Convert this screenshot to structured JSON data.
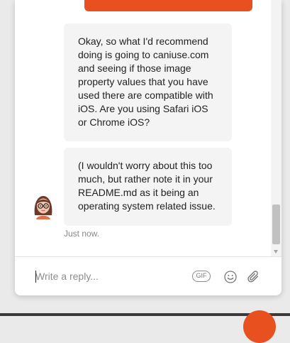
{
  "messages": [
    {
      "text": "Okay, so what I'd recommend doing is going to caniuse.com and seeing if those image property values that you have used there are compatible with iOS. Are you using Safari iOS or Chrome iOS?"
    },
    {
      "text": "(I wouldn't worry about this too much, but rather note it in your README.md as it being an operating system related issue."
    }
  ],
  "timestamp": "Just now.",
  "composer": {
    "placeholder": "Write a reply...",
    "gif_label": "GIF",
    "emoji_icon": "emoji-icon",
    "attach_icon": "paperclip-icon"
  },
  "colors": {
    "accent": "#e8501f",
    "bubble": "#f4f4f4"
  }
}
